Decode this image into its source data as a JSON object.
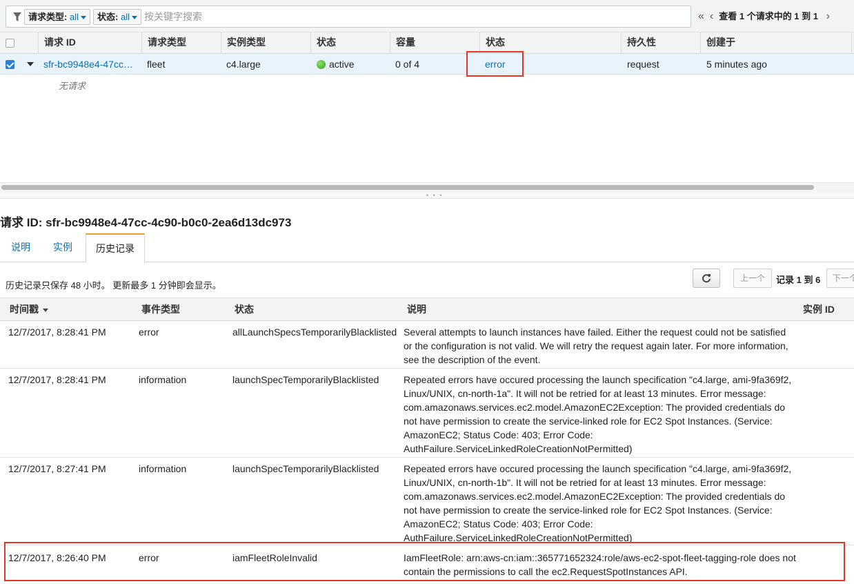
{
  "filter": {
    "chip_type_label": "请求类型:",
    "chip_type_value": "all",
    "chip_state_label": "状态:",
    "chip_state_value": "all",
    "search_placeholder": "按关键字搜索",
    "pager_first": "«",
    "pager_prev": "‹",
    "pager_text": "查看 1 个请求中的 1 到 1",
    "pager_next": "›"
  },
  "requests_table": {
    "columns": [
      "请求 ID",
      "请求类型",
      "实例类型",
      "状态",
      "容量",
      "状态",
      "持久性",
      "创建于"
    ],
    "row": {
      "id": "sfr-bc9948e4-47cc…",
      "type": "fleet",
      "instance_type": "c4.large",
      "state": "active",
      "capacity": "0 of 4",
      "status": "error",
      "persistence": "request",
      "created": "5 minutes ago"
    },
    "no_requests": "无请求"
  },
  "detail": {
    "title": "请求 ID: sfr-bc9948e4-47cc-4c90-b0c0-2ea6d13dc973",
    "tabs": [
      "说明",
      "实例",
      "历史记录"
    ],
    "active_tab": "历史记录",
    "history_note": "历史记录只保存 48 小时。 更新最多 1 分钟即会显示。",
    "refresh_icon": "refresh-icon",
    "btn_prev": "上一个",
    "records_text": "记录 1 到 6",
    "btn_next": "下一个"
  },
  "history_table": {
    "columns": [
      "时间戳",
      "事件类型",
      "状态",
      "说明",
      "实例 ID"
    ],
    "rows": [
      {
        "timestamp": "12/7/2017, 8:28:41 PM",
        "event_type": "error",
        "status": "allLaunchSpecsTemporarilyBlacklisted",
        "description": "Several attempts to launch instances have failed. Either the request could not be satisfied or the configuration is not valid. We will retry the request again later. For more information, see the description of the event.",
        "instance_id": ""
      },
      {
        "timestamp": "12/7/2017, 8:28:41 PM",
        "event_type": "information",
        "status": "launchSpecTemporarilyBlacklisted",
        "description": "Repeated errors have occured processing the launch specification \"c4.large, ami-9fa369f2, Linux/UNIX, cn-north-1a\". It will not be retried for at least 13 minutes. Error message: com.amazonaws.services.ec2.model.AmazonEC2Exception: The provided credentials do not have permission to create the service-linked role for EC2 Spot Instances. (Service: AmazonEC2; Status Code: 403; Error Code: AuthFailure.ServiceLinkedRoleCreationNotPermitted)",
        "instance_id": ""
      },
      {
        "timestamp": "12/7/2017, 8:27:41 PM",
        "event_type": "information",
        "status": "launchSpecTemporarilyBlacklisted",
        "description": "Repeated errors have occured processing the launch specification \"c4.large, ami-9fa369f2, Linux/UNIX, cn-north-1b\". It will not be retried for at least 13 minutes. Error message: com.amazonaws.services.ec2.model.AmazonEC2Exception: The provided credentials do not have permission to create the service-linked role for EC2 Spot Instances. (Service: AmazonEC2; Status Code: 403; Error Code: AuthFailure.ServiceLinkedRoleCreationNotPermitted)",
        "instance_id": ""
      },
      {
        "timestamp": "12/7/2017, 8:26:40 PM",
        "event_type": "error",
        "status": "iamFleetRoleInvalid",
        "description": "IamFleetRole: arn:aws-cn:iam::365771652324:role/aws-ec2-spot-fleet-tagging-role does not contain the permissions to call the ec2.RequestSpotInstances API.",
        "instance_id": ""
      }
    ]
  },
  "colors": {
    "link": "#0073bb",
    "highlight_box": "#e53526",
    "selected_row": "#e8f3fb",
    "active_tab_accent": "#f0a02b",
    "status_active": "#2ea31a"
  }
}
